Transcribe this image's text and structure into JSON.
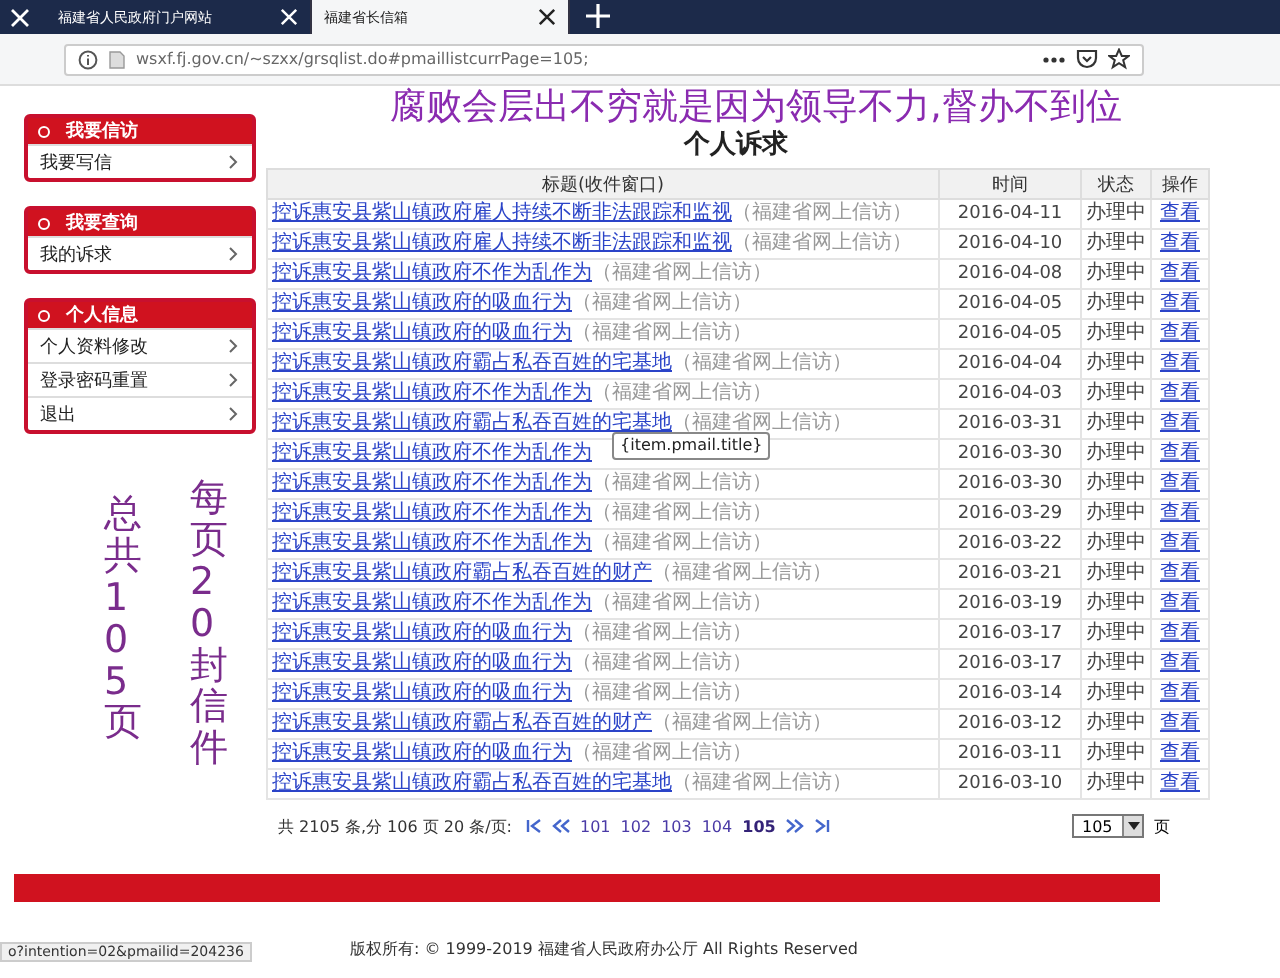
{
  "browser": {
    "tabs": [
      {
        "label": "福建省人民政府门户网站",
        "selected": false
      },
      {
        "label": "福建省长信箱",
        "selected": true
      }
    ],
    "url": "wsxf.fj.gov.cn/~szxx/grsqlist.do#pmaillistcurrPage=105;"
  },
  "headline": "腐败会层出不穷就是因为领导不力,督办不到位",
  "side_notes": [
    "总共105页",
    "每页20封信件"
  ],
  "sidebar": [
    {
      "title": "我要信访",
      "items": [
        "我要写信"
      ]
    },
    {
      "title": "我要查询",
      "items": [
        "我的诉求"
      ]
    },
    {
      "title": "个人信息",
      "items": [
        "个人资料修改",
        "登录密码重置",
        "退出"
      ]
    }
  ],
  "page_title": "个人诉求",
  "table": {
    "columns": [
      "标题(收件窗口)",
      "时间",
      "状态",
      "操作"
    ],
    "rows": [
      {
        "title": "控诉惠安县紫山镇政府雇人持续不断非法跟踪和监视",
        "source": "（福建省网上信访）",
        "date": "2016-04-11",
        "status": "办理中",
        "action": "查看"
      },
      {
        "title": "控诉惠安县紫山镇政府雇人持续不断非法跟踪和监视",
        "source": "（福建省网上信访）",
        "date": "2016-04-10",
        "status": "办理中",
        "action": "查看"
      },
      {
        "title": "控诉惠安县紫山镇政府不作为乱作为",
        "source": "（福建省网上信访）",
        "date": "2016-04-08",
        "status": "办理中",
        "action": "查看"
      },
      {
        "title": "控诉惠安县紫山镇政府的吸血行为",
        "source": "（福建省网上信访）",
        "date": "2016-04-05",
        "status": "办理中",
        "action": "查看"
      },
      {
        "title": "控诉惠安县紫山镇政府的吸血行为",
        "source": "（福建省网上信访）",
        "date": "2016-04-05",
        "status": "办理中",
        "action": "查看"
      },
      {
        "title": "控诉惠安县紫山镇政府霸占私吞百姓的宅基地",
        "source": "（福建省网上信访）",
        "date": "2016-04-04",
        "status": "办理中",
        "action": "查看"
      },
      {
        "title": "控诉惠安县紫山镇政府不作为乱作为",
        "source": "（福建省网上信访）",
        "date": "2016-04-03",
        "status": "办理中",
        "action": "查看"
      },
      {
        "title": "控诉惠安县紫山镇政府霸占私吞百姓的宅基地",
        "source": "（福建省网上信访）",
        "date": "2016-03-31",
        "status": "办理中",
        "action": "查看"
      },
      {
        "title": "控诉惠安县紫山镇政府不作为乱作为",
        "tooltip": "{item.pmail.title}",
        "date": "2016-03-30",
        "status": "办理中",
        "action": "查看"
      },
      {
        "title": "控诉惠安县紫山镇政府不作为乱作为",
        "source": "（福建省网上信访）",
        "date": "2016-03-30",
        "status": "办理中",
        "action": "查看"
      },
      {
        "title": "控诉惠安县紫山镇政府不作为乱作为",
        "source": "（福建省网上信访）",
        "date": "2016-03-29",
        "status": "办理中",
        "action": "查看"
      },
      {
        "title": "控诉惠安县紫山镇政府不作为乱作为",
        "source": "（福建省网上信访）",
        "date": "2016-03-22",
        "status": "办理中",
        "action": "查看"
      },
      {
        "title": "控诉惠安县紫山镇政府霸占私吞百姓的财产",
        "source": "（福建省网上信访）",
        "date": "2016-03-21",
        "status": "办理中",
        "action": "查看"
      },
      {
        "title": "控诉惠安县紫山镇政府不作为乱作为",
        "source": "（福建省网上信访）",
        "date": "2016-03-19",
        "status": "办理中",
        "action": "查看"
      },
      {
        "title": "控诉惠安县紫山镇政府的吸血行为",
        "source": "（福建省网上信访）",
        "date": "2016-03-17",
        "status": "办理中",
        "action": "查看"
      },
      {
        "title": "控诉惠安县紫山镇政府的吸血行为",
        "source": "（福建省网上信访）",
        "date": "2016-03-17",
        "status": "办理中",
        "action": "查看"
      },
      {
        "title": "控诉惠安县紫山镇政府的吸血行为",
        "source": "（福建省网上信访）",
        "date": "2016-03-14",
        "status": "办理中",
        "action": "查看"
      },
      {
        "title": "控诉惠安县紫山镇政府霸占私吞百姓的财产",
        "source": "（福建省网上信访）",
        "date": "2016-03-12",
        "status": "办理中",
        "action": "查看"
      },
      {
        "title": "控诉惠安县紫山镇政府的吸血行为",
        "source": "（福建省网上信访）",
        "date": "2016-03-11",
        "status": "办理中",
        "action": "查看"
      },
      {
        "title": "控诉惠安县紫山镇政府霸占私吞百姓的宅基地",
        "source": "（福建省网上信访）",
        "date": "2016-03-10",
        "status": "办理中",
        "action": "查看"
      }
    ]
  },
  "pagination": {
    "summary": "共 2105 条,分 106 页 20 条/页:",
    "pages": [
      {
        "label": "101",
        "selected": false
      },
      {
        "label": "102",
        "selected": false
      },
      {
        "label": "103",
        "selected": false
      },
      {
        "label": "104",
        "selected": false
      },
      {
        "label": "105",
        "selected": true
      }
    ],
    "page_select": "105",
    "suffix": "页"
  },
  "footer": "版权所有: © 1999-2019 福建省人民政府办公厅 All Rights Reserved",
  "status_url": "o?intention=02&pmailid=204236"
}
